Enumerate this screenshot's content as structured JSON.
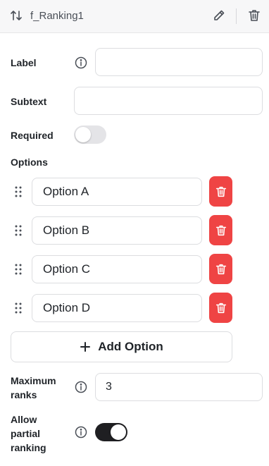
{
  "header": {
    "title": "f_Ranking1",
    "icons": {
      "sort": "sort-arrows-icon",
      "edit": "pencil-icon",
      "delete": "trash-icon"
    }
  },
  "fields": {
    "label": {
      "label": "Label",
      "value": "",
      "icon": "info-icon"
    },
    "subtext": {
      "label": "Subtext",
      "value": ""
    },
    "required": {
      "label": "Required",
      "on": false
    }
  },
  "options": {
    "heading": "Options",
    "items": [
      {
        "value": "Option A"
      },
      {
        "value": "Option B"
      },
      {
        "value": "Option C"
      },
      {
        "value": "Option D"
      }
    ],
    "add_label": "Add Option",
    "add_icon": "plus-icon"
  },
  "max_ranks": {
    "label_line1": "Maximum",
    "label_line2": "ranks",
    "value": "3",
    "icon": "info-icon"
  },
  "partial": {
    "label_line1": "Allow",
    "label_line2": "partial",
    "label_line3": "ranking",
    "on": true,
    "icon": "info-icon"
  },
  "colors": {
    "danger": "#ef4444",
    "toggle_on": "#1f1f22",
    "toggle_off": "#e4e4e7",
    "border": "#dcdde0"
  }
}
